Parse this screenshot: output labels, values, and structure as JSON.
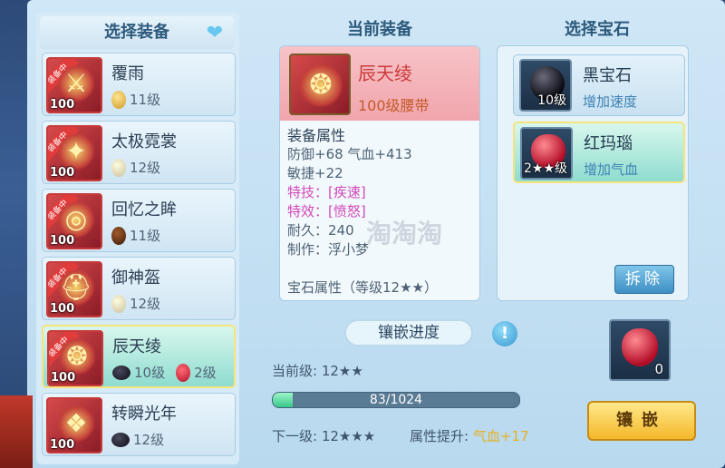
{
  "left": {
    "header": "选择装备",
    "items": [
      {
        "name": "覆雨",
        "level_badge": "100",
        "equipped_badge": "装备中",
        "gems": [
          {
            "type": "gold",
            "label": "11级"
          }
        ]
      },
      {
        "name": "太极霓裳",
        "level_badge": "100",
        "equipped_badge": "装备中",
        "gems": [
          {
            "type": "pearl",
            "label": "12级"
          }
        ]
      },
      {
        "name": "回忆之眸",
        "level_badge": "100",
        "equipped_badge": "装备中",
        "gems": [
          {
            "type": "amber",
            "label": "11级"
          }
        ]
      },
      {
        "name": "御神盔",
        "level_badge": "100",
        "equipped_badge": "装备中",
        "gems": [
          {
            "type": "pearl",
            "label": "12级"
          }
        ]
      },
      {
        "name": "辰天绫",
        "level_badge": "100",
        "equipped_badge": "装备中",
        "gems": [
          {
            "type": "black",
            "label": "10级"
          },
          {
            "type": "red",
            "label": "2级"
          }
        ]
      },
      {
        "name": "转瞬光年",
        "level_badge": "100",
        "equipped_badge": "装备中",
        "gems": [
          {
            "type": "black",
            "label": "12级"
          }
        ]
      }
    ]
  },
  "middle": {
    "header": "当前装备",
    "card": {
      "name": "辰天绫",
      "subtitle": "100级腰带",
      "attr_title": "装备属性",
      "lines": [
        {
          "text": "防御+68 气血+413",
          "style": "normal"
        },
        {
          "text": "敏捷+22",
          "style": "normal"
        },
        {
          "text": "特技：[疾速]",
          "style": "pink"
        },
        {
          "text": "特效：[愤怒]",
          "style": "pink"
        },
        {
          "text": "耐久：240",
          "style": "normal"
        },
        {
          "text": "制作：浮小梦",
          "style": "normal"
        },
        {
          "text": "",
          "style": "normal"
        },
        {
          "text": "宝石属性（等级12★★）",
          "style": "cut"
        }
      ]
    },
    "watermark": "淘淘淘",
    "progress": {
      "title": "镶嵌进度",
      "info_icon": "!",
      "current_label": "当前级: 12★★",
      "bar_text": "83/1024",
      "bar_fraction": 0.081,
      "next_label": "下一级: 12★★★",
      "attr_up_label": "属性提升:",
      "attr_up_value": "气血+17"
    }
  },
  "right": {
    "header": "选择宝石",
    "gems": [
      {
        "name": "黑宝石",
        "desc": "增加速度",
        "level": "10级",
        "stone": "black"
      },
      {
        "name": "红玛瑙",
        "desc": "增加气血",
        "level": "2★★级",
        "stone": "red"
      }
    ],
    "remove_label": "拆除",
    "slot_count": "0",
    "inlay_label": "镶嵌"
  },
  "colors": {
    "accent_gold": "#f3b82a",
    "pink_text": "#d347b8",
    "selected_border": "#f6e47a"
  }
}
